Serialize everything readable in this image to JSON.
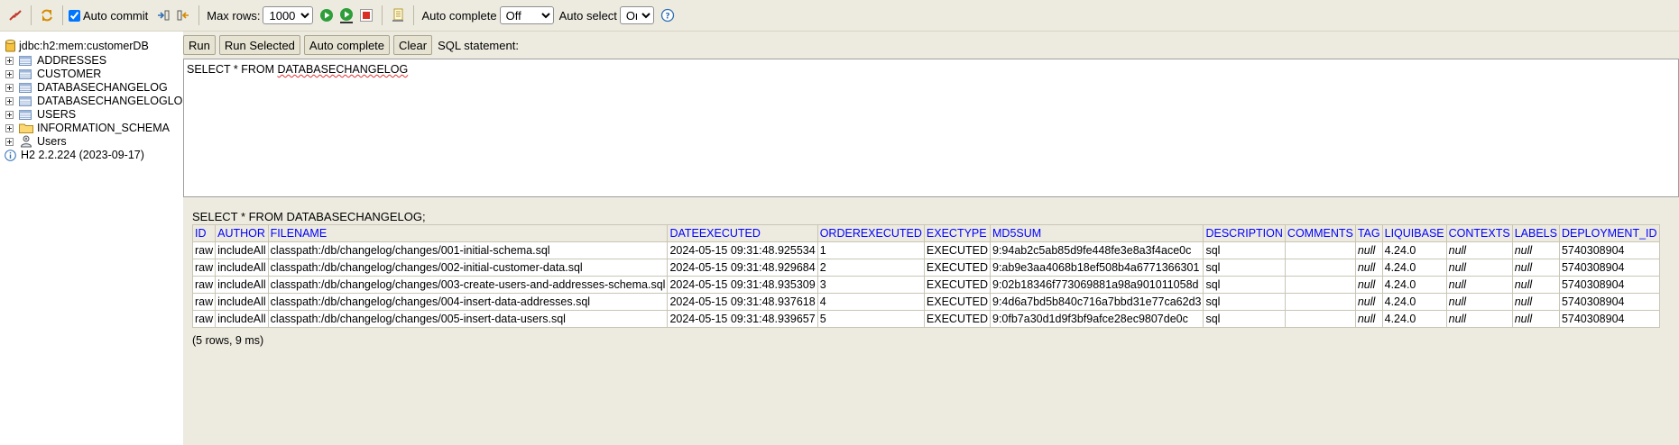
{
  "toolbar": {
    "auto_commit_label": "Auto commit",
    "auto_commit_checked": true,
    "max_rows_label": "Max rows:",
    "max_rows_value": "1000",
    "auto_complete_label": "Auto complete",
    "auto_complete_value": "Off",
    "auto_select_label": "Auto select",
    "auto_select_value": "On"
  },
  "tree": {
    "connection": "jdbc:h2:mem:customerDB",
    "items": [
      {
        "label": "ADDRESSES",
        "type": "table"
      },
      {
        "label": "CUSTOMER",
        "type": "table"
      },
      {
        "label": "DATABASECHANGELOG",
        "type": "table"
      },
      {
        "label": "DATABASECHANGELOGLOCK",
        "type": "table"
      },
      {
        "label": "USERS",
        "type": "table"
      },
      {
        "label": "INFORMATION_SCHEMA",
        "type": "folder"
      },
      {
        "label": "Users",
        "type": "users"
      }
    ],
    "version": "H2 2.2.224 (2023-09-17)"
  },
  "query_bar": {
    "run": "Run",
    "run_selected": "Run Selected",
    "auto_complete": "Auto complete",
    "clear": "Clear",
    "sql_statement_label": "SQL statement:"
  },
  "editor": {
    "prefix": "SELECT * FROM ",
    "table": "DATABASECHANGELOG"
  },
  "results": {
    "query": "SELECT * FROM DATABASECHANGELOG;",
    "columns": [
      "ID",
      "AUTHOR",
      "FILENAME",
      "DATEEXECUTED",
      "ORDEREXECUTED",
      "EXECTYPE",
      "MD5SUM",
      "DESCRIPTION",
      "COMMENTS",
      "TAG",
      "LIQUIBASE",
      "CONTEXTS",
      "LABELS",
      "DEPLOYMENT_ID"
    ],
    "rows": [
      [
        "raw",
        "includeAll",
        "classpath:/db/changelog/changes/001-initial-schema.sql",
        "2024-05-15 09:31:48.925534",
        "1",
        "EXECUTED",
        "9:94ab2c5ab85d9fe448fe3e8a3f4ace0c",
        "sql",
        "",
        "null",
        "4.24.0",
        "null",
        "null",
        "5740308904"
      ],
      [
        "raw",
        "includeAll",
        "classpath:/db/changelog/changes/002-initial-customer-data.sql",
        "2024-05-15 09:31:48.929684",
        "2",
        "EXECUTED",
        "9:ab9e3aa4068b18ef508b4a6771366301",
        "sql",
        "",
        "null",
        "4.24.0",
        "null",
        "null",
        "5740308904"
      ],
      [
        "raw",
        "includeAll",
        "classpath:/db/changelog/changes/003-create-users-and-addresses-schema.sql",
        "2024-05-15 09:31:48.935309",
        "3",
        "EXECUTED",
        "9:02b18346f773069881a98a901011058d",
        "sql",
        "",
        "null",
        "4.24.0",
        "null",
        "null",
        "5740308904"
      ],
      [
        "raw",
        "includeAll",
        "classpath:/db/changelog/changes/004-insert-data-addresses.sql",
        "2024-05-15 09:31:48.937618",
        "4",
        "EXECUTED",
        "9:4d6a7bd5b840c716a7bbd31e77ca62d3",
        "sql",
        "",
        "null",
        "4.24.0",
        "null",
        "null",
        "5740308904"
      ],
      [
        "raw",
        "includeAll",
        "classpath:/db/changelog/changes/005-insert-data-users.sql",
        "2024-05-15 09:31:48.939657",
        "5",
        "EXECUTED",
        "9:0fb7a30d1d9f3bf9afce28ec9807de0c",
        "sql",
        "",
        "null",
        "4.24.0",
        "null",
        "null",
        "5740308904"
      ]
    ],
    "summary": "(5 rows, 9 ms)"
  }
}
